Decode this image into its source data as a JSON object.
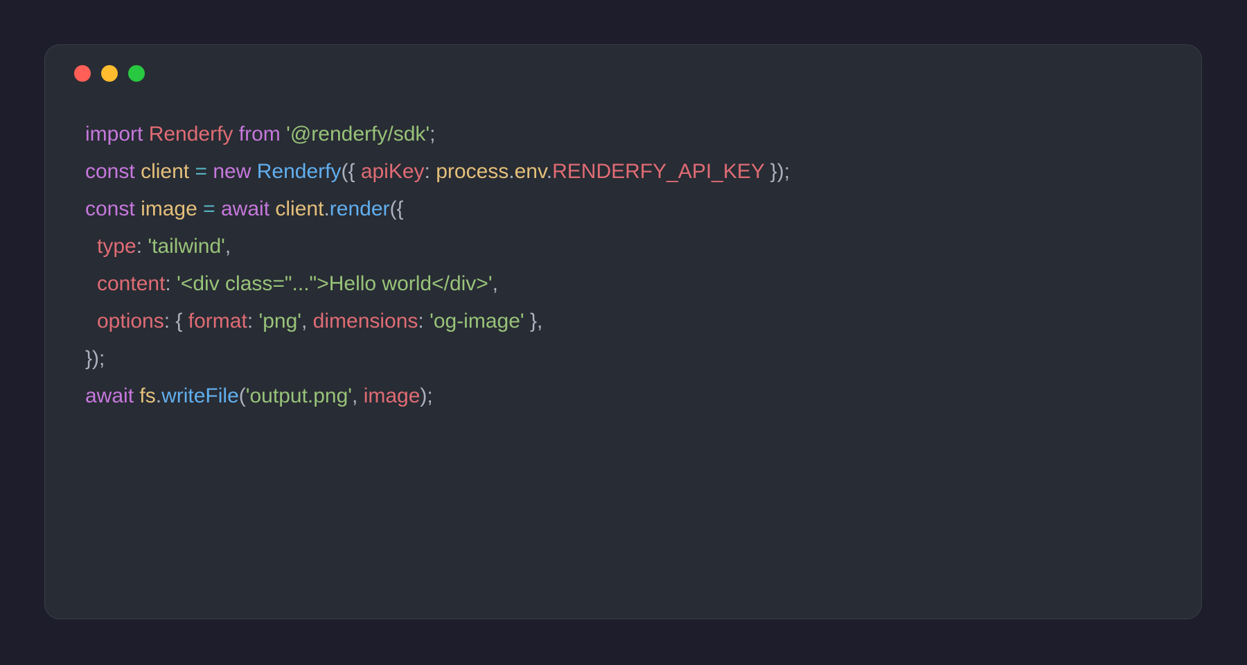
{
  "window": {
    "controls": [
      "close",
      "minimize",
      "maximize"
    ]
  },
  "colors": {
    "background": "#1d1d2c",
    "panel": "#282c34",
    "keyword": "#c678dd",
    "string": "#98c379",
    "property": "#e06c75",
    "function": "#61afef",
    "variable": "#e5c07b",
    "operator": "#56b6c2",
    "punctuation": "#abb2bf"
  },
  "code": {
    "line1": {
      "t1": "import",
      "t2": " ",
      "t3": "Renderfy",
      "t4": " ",
      "t5": "from",
      "t6": " ",
      "t7": "'@renderfy/sdk'",
      "t8": ";"
    },
    "line2": {
      "t1": "const",
      "t2": " ",
      "t3": "client",
      "t4": " ",
      "t5": "=",
      "t6": " ",
      "t7": "new",
      "t8": " ",
      "t9": "Renderfy",
      "t10": "({ ",
      "t11": "apiKey",
      "t12": ": ",
      "t13": "process",
      "t14": ".",
      "t15": "env",
      "t16": ".",
      "t17": "RENDERFY_API_KEY",
      "t18": " });"
    },
    "line3": {
      "t1": "const",
      "t2": " ",
      "t3": "image",
      "t4": " ",
      "t5": "=",
      "t6": " ",
      "t7": "await",
      "t8": " ",
      "t9": "client",
      "t10": ".",
      "t11": "render",
      "t12": "({"
    },
    "line4": {
      "t1": "type",
      "t2": ": ",
      "t3": "'tailwind'",
      "t4": ","
    },
    "line5": {
      "t1": "content",
      "t2": ": ",
      "t3": "'<div class=\"...\">Hello world</div>'",
      "t4": ","
    },
    "line6": {
      "t1": "options",
      "t2": ": { ",
      "t3": "format",
      "t4": ": ",
      "t5": "'png'",
      "t6": ", ",
      "t7": "dimensions",
      "t8": ": ",
      "t9": "'og-image'",
      "t10": " },"
    },
    "line7": {
      "t1": "});"
    },
    "line8": {
      "t1": "await",
      "t2": " ",
      "t3": "fs",
      "t4": ".",
      "t5": "writeFile",
      "t6": "(",
      "t7": "'output.png'",
      "t8": ", ",
      "t9": "image",
      "t10": ");"
    }
  }
}
